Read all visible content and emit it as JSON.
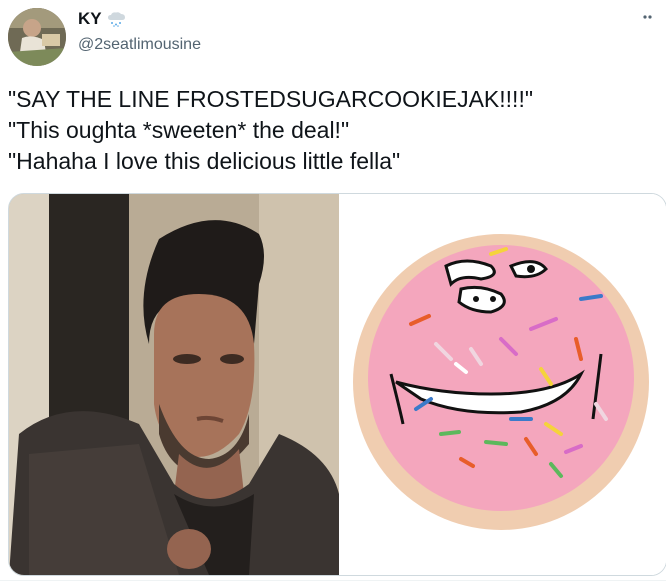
{
  "author": {
    "display_name": "KY",
    "handle": "@2seatlimousine",
    "badge_icon": "snow-cloud-icon"
  },
  "tweet": {
    "lines": [
      "\"SAY THE LINE FROSTEDSUGARCOOKIEJAK!!!!\"",
      "\"This oughta *sweeten* the deal!\"",
      "\"Hahaha I love this delicious little fella\""
    ]
  },
  "media": {
    "images": [
      "man-portrait-photo",
      "frosted-sugar-cookie-face-drawing"
    ]
  },
  "colors": {
    "text_primary": "#0f1419",
    "text_secondary": "#536471",
    "border": "#cfd9de",
    "cookie_pink": "#f4a6bd",
    "cookie_base": "#f0cdb0"
  }
}
